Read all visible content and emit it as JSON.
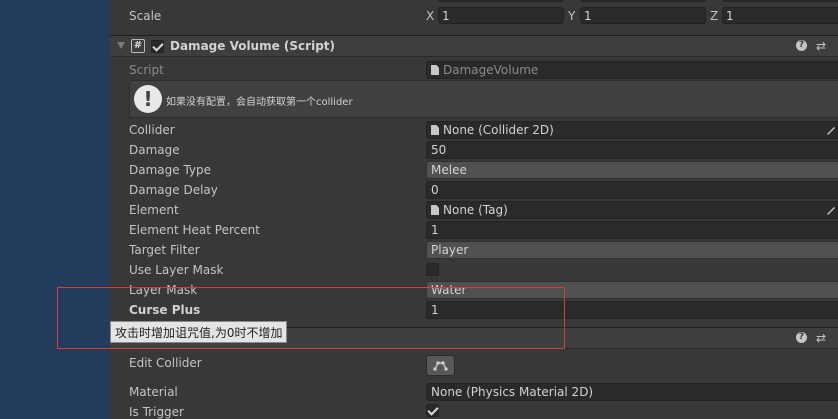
{
  "transform": {
    "scale_label": "Scale",
    "scale_x_label": "X",
    "scale_x": "1",
    "scale_y_label": "Y",
    "scale_y": "1",
    "scale_z_label": "Z",
    "scale_z": "1"
  },
  "damage_volume": {
    "title": "Damage Volume (Script)",
    "script_label": "Script",
    "script_value": "DamageVolume",
    "help_text": "如果没有配置，会自动获取第一个collider",
    "fields": {
      "collider_label": "Collider",
      "collider_value": "None (Collider 2D)",
      "damage_label": "Damage",
      "damage_value": "50",
      "damage_type_label": "Damage Type",
      "damage_type_value": "Melee",
      "damage_delay_label": "Damage Delay",
      "damage_delay_value": "0",
      "element_label": "Element",
      "element_value": "None (Tag)",
      "element_heat_label": "Element Heat Percent",
      "element_heat_value": "1",
      "target_filter_label": "Target Filter",
      "target_filter_value": "Player",
      "use_layer_mask_label": "Use Layer Mask",
      "layer_mask_label": "Layer Mask",
      "layer_mask_value": "Water",
      "curse_plus_label": "Curse Plus",
      "curse_plus_value": "1"
    },
    "use_layer_mask_checked": false
  },
  "tooltip": "攻击时增加诅咒值,为0时不增加",
  "collider_component": {
    "edit_collider_label": "Edit Collider",
    "material_label": "Material",
    "material_value": "None (Physics Material 2D)",
    "is_trigger_label": "Is Trigger",
    "is_trigger_checked": true
  },
  "icons": {
    "help": "?",
    "settings": "⇄",
    "warning": "!",
    "script_hash": "#"
  },
  "colors": {
    "left_bar": "#243c5c",
    "panel_bg": "#383838",
    "highlight_border": "#d14040"
  }
}
